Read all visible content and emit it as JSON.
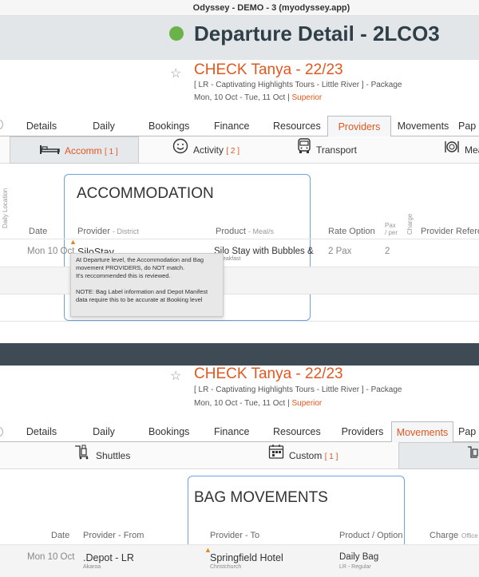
{
  "window": {
    "title": "Odyssey - DEMO - 3 (myodyssey.app)"
  },
  "departure": {
    "title": "Departure Detail - 2LCO3",
    "status_color": "#6bb24a"
  },
  "booking": {
    "title": "CHECK Tanya - 22/23",
    "subtitle": "[ LR - Captivating Highlights Tours - Little River ] - Package",
    "dates": "Mon, 10 Oct  - Tue, 11 Oct  |",
    "grade": "Superior"
  },
  "tabs": [
    "Details",
    "Daily",
    "Bookings",
    "Finance",
    "Resources",
    "Providers",
    "Movements",
    "Pap"
  ],
  "panel1": {
    "active_tab": "Providers",
    "subtabs": [
      {
        "label": "Accomm",
        "count": "[ 1 ]",
        "icon": "bed-icon"
      },
      {
        "label": "Activity",
        "count": "[ 2 ]",
        "icon": "smiley-icon"
      },
      {
        "label": "Transport",
        "count": "",
        "icon": "bus-icon"
      },
      {
        "label": "Mea",
        "count": "",
        "icon": "dining-icon"
      }
    ],
    "heading": "ACCOMMODATION",
    "side_label": "Daily Location",
    "columns": {
      "date": "Date",
      "provider": "Provider",
      "district": "- District",
      "product": "Product",
      "meals": "- Meal/s",
      "rate": "Rate Option",
      "pax_per_1": "Pax",
      "pax_per_2": "/ per",
      "charge": "Charge",
      "provider_ref": "Provider Referen"
    },
    "row": {
      "date": "Mon 10 Oct",
      "provider": "SiloStay",
      "product": "Silo Stay with Bubbles &",
      "product_sub": "eakfast",
      "rate": "2 Pax",
      "pax_per": "2"
    },
    "tooltip": {
      "line1": "At Departure level, the Accommodation and Bag movement PROVIDERS, do NOT match.",
      "line2": "It's reccommended this is reviewed.",
      "line3": "NOTE: Bag Label information and Depot Manifest data require this to be accurate at Booking level"
    }
  },
  "panel2": {
    "active_tab": "Movements",
    "subtabs": [
      {
        "label": "Shuttles",
        "count": "",
        "icon": "luggage-cart-icon"
      },
      {
        "label": "Custom",
        "count": "[ 1 ]",
        "icon": "calendar-icon"
      }
    ],
    "heading": "BAG MOVEMENTS",
    "columns": {
      "date": "Date",
      "from": "Provider - From",
      "to": "Provider - To",
      "product": "Product / Option",
      "charge": "Charge",
      "office": "Office"
    },
    "row": {
      "date": "Mon 10 Oct",
      "from": ".Depot - LR",
      "from_sub": "Akaroa",
      "to": "Springfield Hotel",
      "to_sub": "Christchurch",
      "product": "Daily Bag",
      "product_sub": "LR - Regular"
    }
  },
  "colors": {
    "accent": "#e2571e",
    "frame": "#6fa0e0",
    "divider": "#3e4b54"
  }
}
